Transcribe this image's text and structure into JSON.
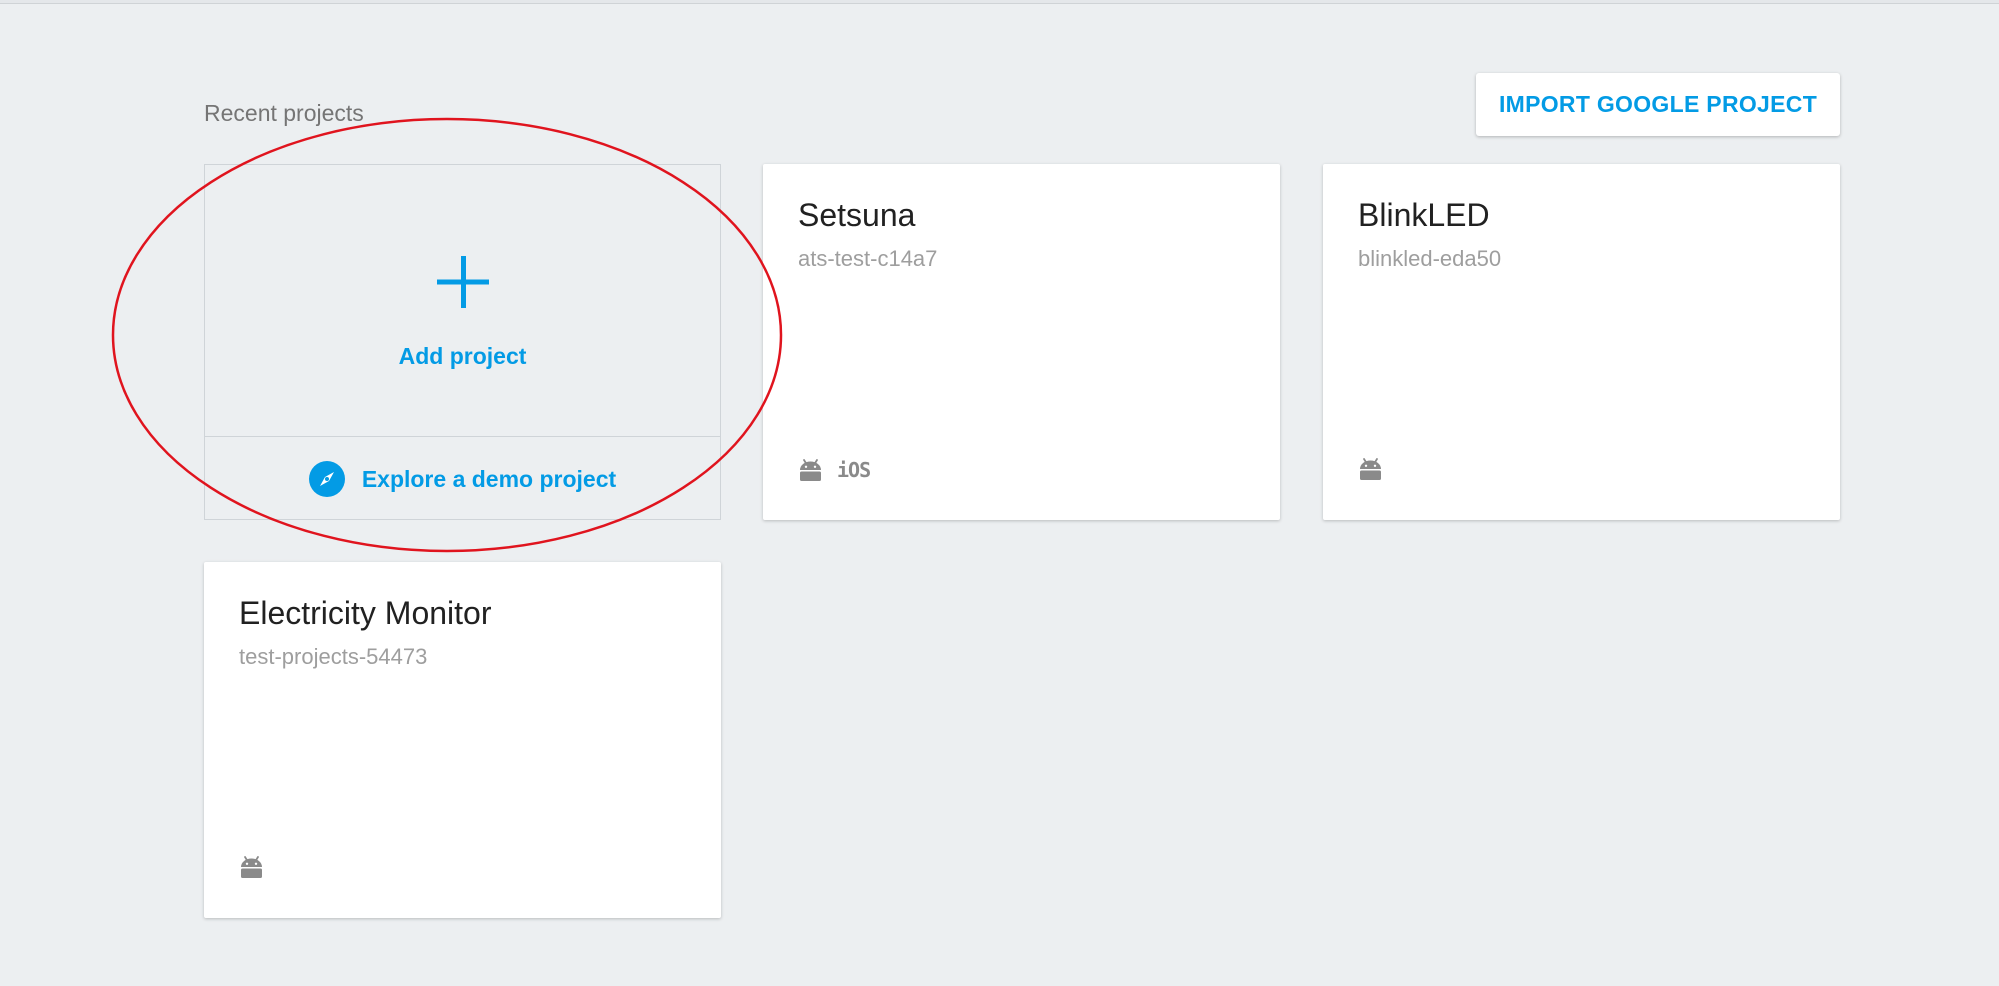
{
  "section_label": "Recent projects",
  "import_button_label": "IMPORT GOOGLE PROJECT",
  "add_card": {
    "add_label": "Add project",
    "demo_label": "Explore a demo project"
  },
  "projects": [
    {
      "name": "Setsuna",
      "id": "ats-test-c14a7",
      "platform_icons": [
        "android-icon",
        "ios-icon"
      ],
      "ios_label": "iOS"
    },
    {
      "name": "BlinkLED",
      "id": "blinkled-eda50",
      "platform_icons": [
        "android-icon"
      ]
    },
    {
      "name": "Electricity Monitor",
      "id": "test-projects-54473",
      "platform_icons": [
        "android-icon"
      ]
    }
  ],
  "colors": {
    "accent": "#039be5",
    "background": "#eceff1",
    "annotation": "#e0141e"
  }
}
